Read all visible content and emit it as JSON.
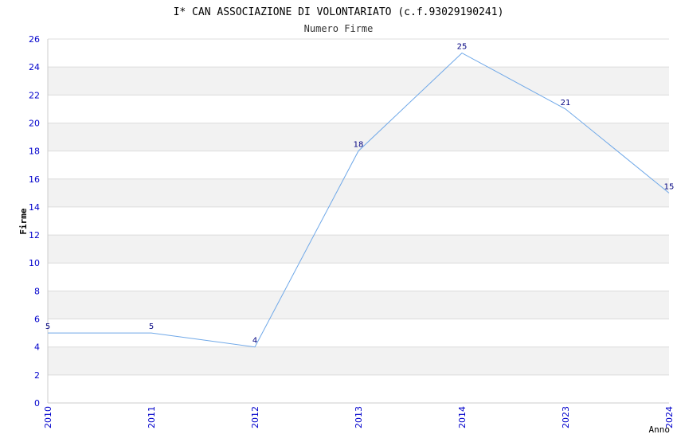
{
  "chart_data": {
    "type": "line",
    "title": "I* CAN ASSOCIAZIONE DI VOLONTARIATO (c.f.93029190241)",
    "subtitle": "Numero Firme",
    "xlabel": "Anno",
    "ylabel": "Firme",
    "categories": [
      "2010",
      "2011",
      "2012",
      "2013",
      "2014",
      "2023",
      "2024"
    ],
    "series": [
      {
        "values": [
          5,
          5,
          4,
          18,
          25,
          21,
          15
        ]
      }
    ],
    "ylim": [
      0,
      26
    ],
    "yticks": [
      0,
      2,
      4,
      6,
      8,
      10,
      12,
      14,
      16,
      18,
      20,
      22,
      24,
      26
    ],
    "grid": true,
    "band_colors": [
      "#ffffff",
      "#f2f2f2"
    ],
    "line_color": "#6fa8e8",
    "tick_color": "#0000cc",
    "label_color": "#000080"
  }
}
